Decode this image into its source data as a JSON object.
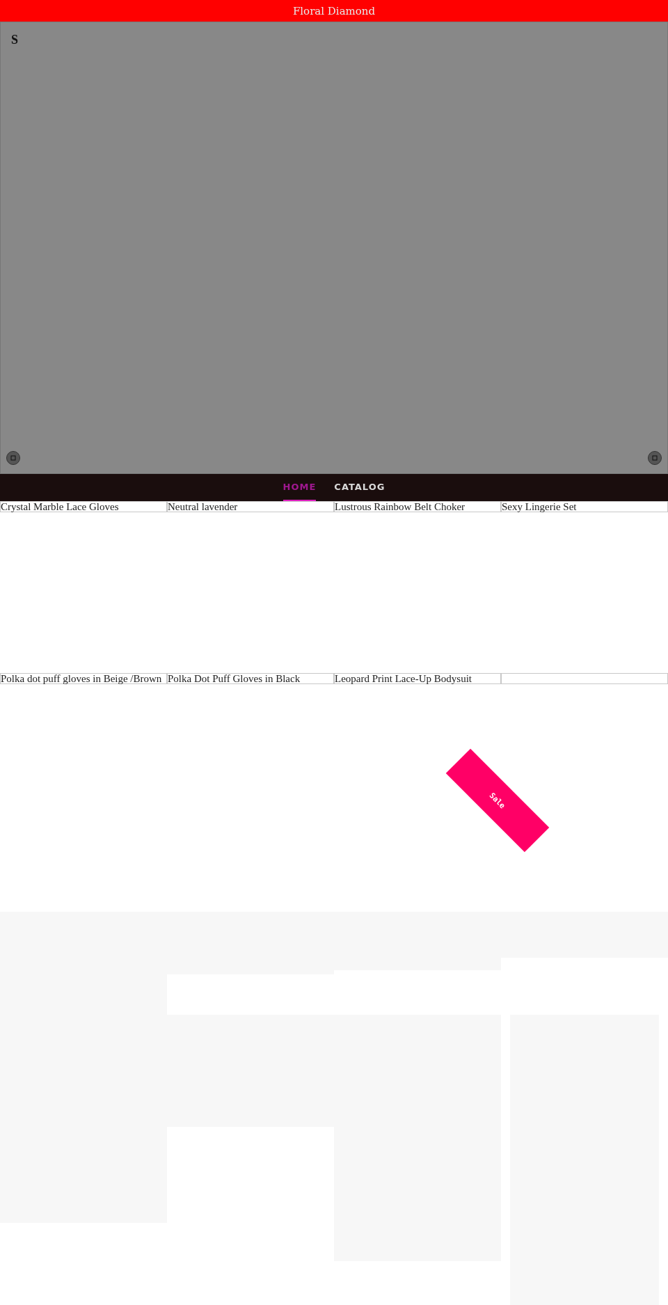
{
  "header": {
    "title": "Floral Diamond"
  },
  "hero": {
    "text": "S"
  },
  "nav": [
    {
      "label": "HOME",
      "selected": true
    },
    {
      "label": "CATALOG",
      "selected": false
    }
  ],
  "products": [
    {
      "name": "Crystal Marble Lace Gloves"
    },
    {
      "name": "Neutral lavender"
    },
    {
      "name": "Lustrous Rainbow Belt Choker"
    },
    {
      "name": "Sexy Lingerie Set"
    },
    {
      "name": "Polka dot puff gloves in Beige /Brown"
    },
    {
      "name": "Polka Dot Puff Gloves in Black"
    },
    {
      "name": "Leopard Print Lace-Up Bodysuit"
    }
  ],
  "sale_badge": {
    "label": "Sale"
  }
}
